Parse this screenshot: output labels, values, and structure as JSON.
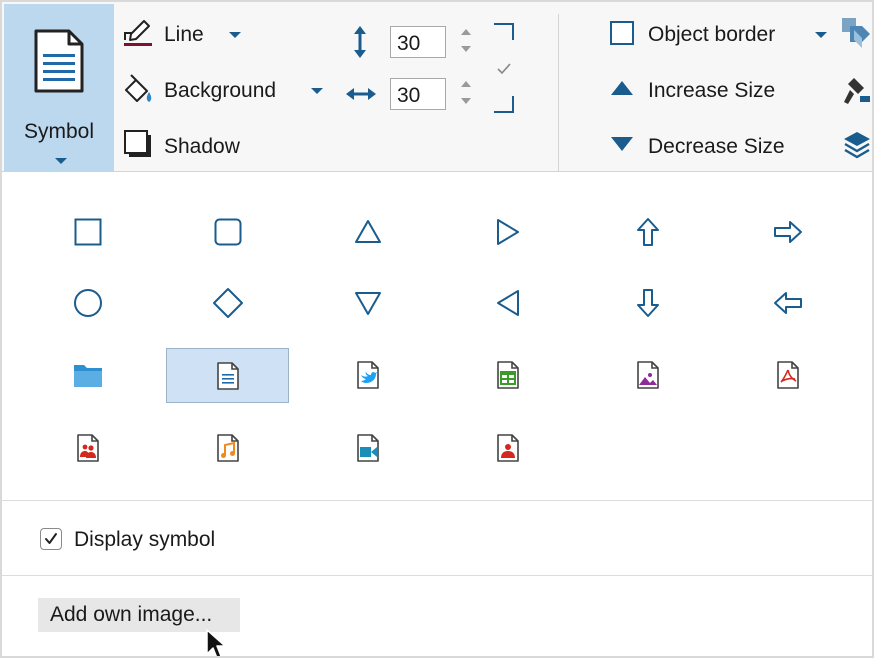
{
  "ribbon": {
    "symbol_label": "Symbol",
    "line_label": "Line",
    "background_label": "Background",
    "shadow_label": "Shadow",
    "height_value": "30",
    "width_value": "30",
    "object_border_label": "Object border",
    "increase_size_label": "Increase Size",
    "decrease_size_label": "Decrease Size"
  },
  "gallery": {
    "rows": [
      [
        "square",
        "rounded-square",
        "triangle-up",
        "triangle-right",
        "arrow-up",
        "arrow-right"
      ],
      [
        "circle",
        "diamond",
        "triangle-down",
        "triangle-left",
        "arrow-down",
        "arrow-left"
      ],
      [
        "folder",
        "document",
        "twitter-file",
        "spreadsheet-file",
        "image-file",
        "pdf-file"
      ],
      [
        "contacts-file",
        "music-file",
        "video-file",
        "person-file"
      ]
    ],
    "selected": "document"
  },
  "options": {
    "display_symbol_label": "Display symbol",
    "display_symbol_checked": true,
    "add_image_label": "Add own image..."
  },
  "colors": {
    "accent": "#1a5c8e",
    "selected_tile": "#bcd8ef",
    "selected_cell": "#cfe1f4"
  }
}
